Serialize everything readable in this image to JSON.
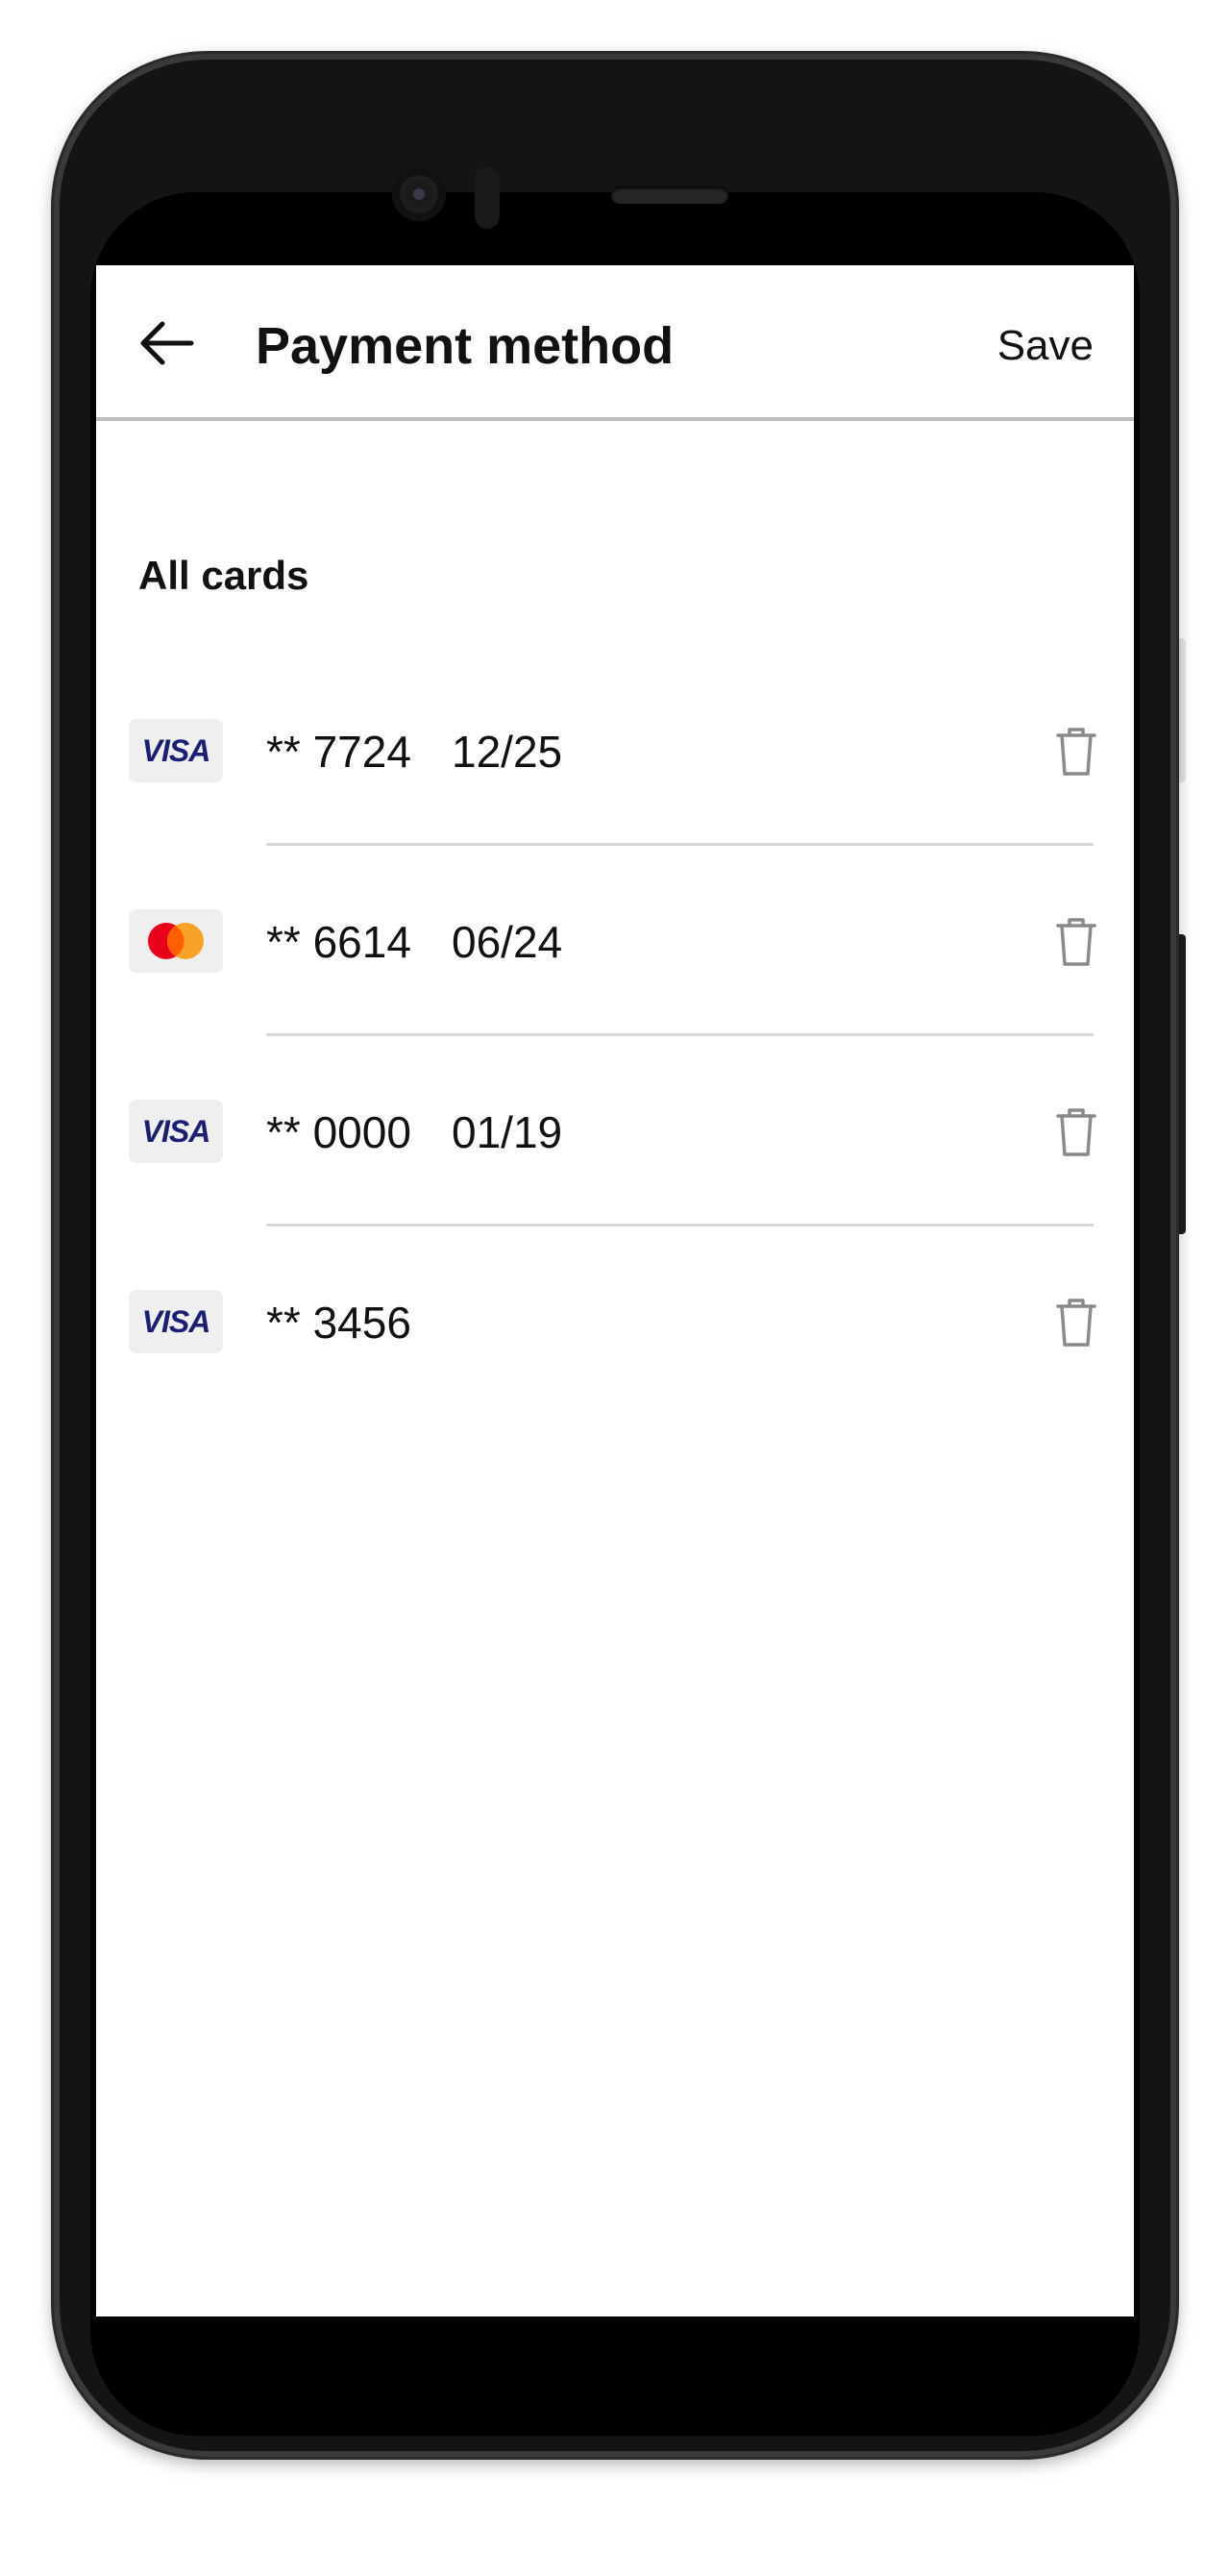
{
  "header": {
    "title": "Payment method",
    "save_label": "Save",
    "back_icon": "arrow-left-icon"
  },
  "section": {
    "title": "All cards"
  },
  "cards": [
    {
      "brand": "visa",
      "brand_label": "VISA",
      "number": "** 7724",
      "expiry": "12/25",
      "delete_icon": "trash-icon"
    },
    {
      "brand": "mastercard",
      "brand_label": "",
      "number": "** 6614",
      "expiry": "06/24",
      "delete_icon": "trash-icon"
    },
    {
      "brand": "visa",
      "brand_label": "VISA",
      "number": "** 0000",
      "expiry": "01/19",
      "delete_icon": "trash-icon"
    },
    {
      "brand": "visa",
      "brand_label": "VISA",
      "number": "** 3456",
      "expiry": "",
      "delete_icon": "trash-icon"
    }
  ],
  "colors": {
    "visa_blue": "#1a1f71",
    "mastercard_red": "#eb001b",
    "mastercard_orange": "#f79e1b",
    "icon_gray": "#8a8a8a",
    "divider": "#d8d8d8"
  }
}
